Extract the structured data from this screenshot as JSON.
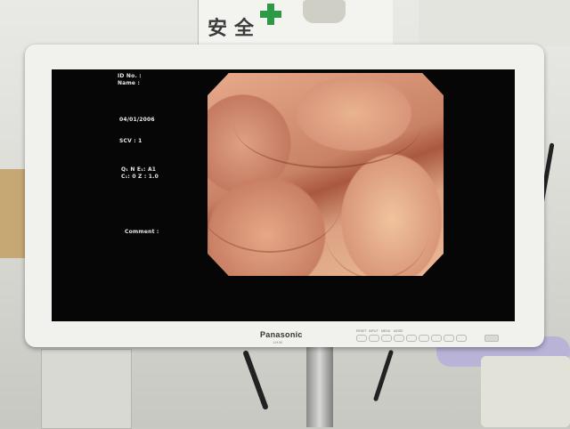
{
  "wall_sign": {
    "chars": [
      "安",
      "全"
    ]
  },
  "monitor": {
    "brand": "Panasonic",
    "model": "LH-M",
    "controls": [
      "RESET",
      "INPUT",
      "MENU",
      "MODE",
      "",
      "",
      "",
      "",
      ""
    ]
  },
  "overlay": {
    "id_label": "ID No. :",
    "name_label": "Name :",
    "date": "04/01/2006",
    "scv": "SCV :  1",
    "settings_line1": "Q₁ N E₁: A1",
    "settings_line2": "C₁: 0  Z : 1.0",
    "comment_label": "Comment :"
  },
  "icons": {
    "cross": "green-cross-icon",
    "power": "power-icon"
  },
  "colors": {
    "cross": "#2e9a48",
    "screen": "#060607",
    "bezel": "#f1f1ee"
  }
}
